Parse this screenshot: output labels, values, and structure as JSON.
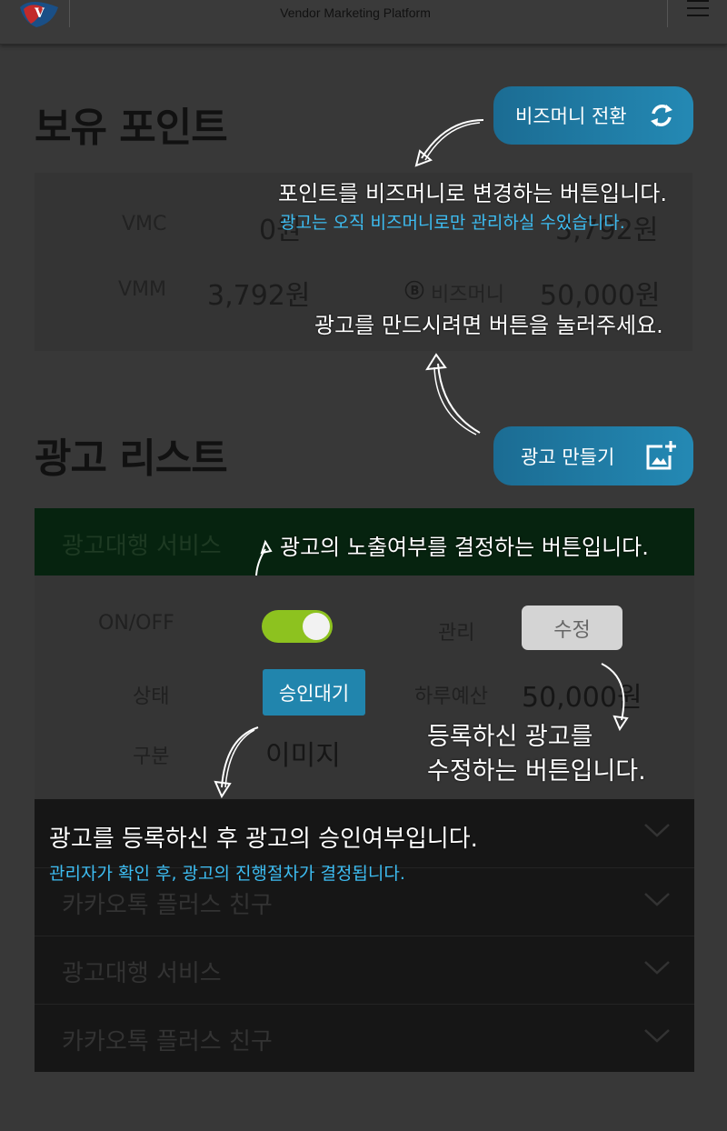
{
  "header": {
    "title": "Vendor Marketing Platform",
    "logo_letter": "V"
  },
  "points": {
    "section_title": "보유 포인트",
    "convert_button": "비즈머니 전환",
    "rows": [
      {
        "label": "VMC",
        "value": "0원"
      },
      {
        "label": "VMM",
        "value": "3,792원"
      },
      {
        "label": "비즈머니",
        "value": "50,000원"
      }
    ],
    "partial_value": "3,792원"
  },
  "help": {
    "convert": "포인트를 비즈머니로 변경하는 버튼입니다.",
    "convert_sub": "광고는 오직 비즈머니로만 관리하실 수있습니다.",
    "create": "광고를 만드시려면 버튼을 눌러주세요.",
    "toggle": "광고의 노출여부를 결정하는 버튼입니다.",
    "edit_line1": "등록하신 광고를",
    "edit_line2": "수정하는 버튼입니다.",
    "status": "광고를 등록하신 후 광고의 승인여부입니다.",
    "status_sub": "관리자가 확인 후, 광고의 진행절차가 결정됩니다."
  },
  "ads": {
    "section_title": "광고 리스트",
    "create_button": "광고 만들기",
    "card": {
      "title": "광고대행 서비스",
      "onoff_label": "ON/OFF",
      "toggle_on": true,
      "manage_label": "관리",
      "edit_button": "수정",
      "status_label": "상태",
      "status_value": "승인대기",
      "budget_label": "하루예산",
      "budget_value": "50,000원",
      "type_label": "구분",
      "type_value": "이미지"
    },
    "list": [
      {
        "label": ""
      },
      {
        "label": "카카오톡 플러스 친구"
      },
      {
        "label": "광고대행 서비스"
      },
      {
        "label": "카카오톡 플러스 친구"
      }
    ]
  },
  "colors": {
    "accent": "#2185ad",
    "toggle": "#8dc21f",
    "help_sub": "#3dbdf2"
  }
}
